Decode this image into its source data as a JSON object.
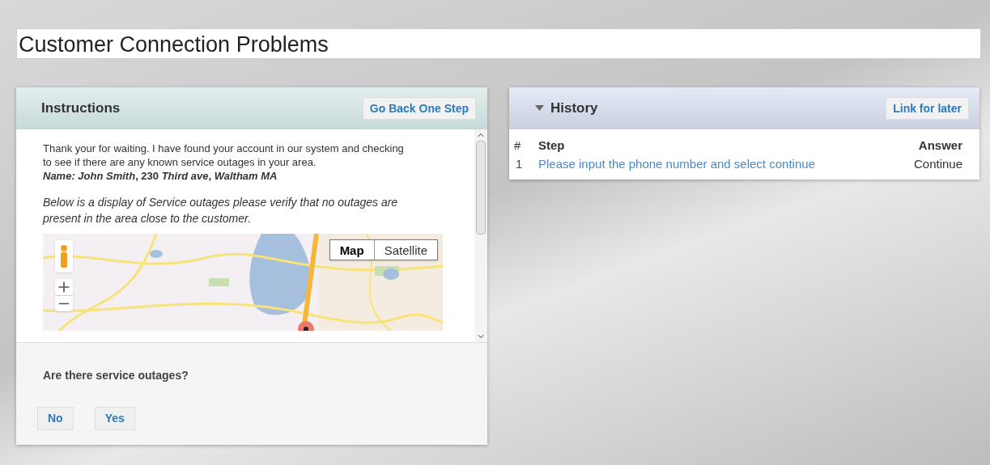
{
  "title": "Customer Connection Problems",
  "instructions": {
    "heading": "Instructions",
    "back_button": "Go Back One Step",
    "paragraphs": [
      "Thank your for waiting.  I have found your account in our system and checking to see if there are any known service outages in your area.",
      "*Name: John Smith*, 230 *Third ave*, *Waltham MA*",
      "Below is a display of Service outages please verify that no outages are present in the area close to the customer."
    ],
    "map": {
      "kind": "picture",
      "map_types": [
        {
          "label": "Map",
          "selected": true
        },
        {
          "label": "Satellite",
          "selected": false
        }
      ]
    },
    "question": "Are there service outages?",
    "answers": [
      "No",
      "Yes"
    ]
  },
  "history": {
    "heading": "History",
    "expanded": true,
    "link_button": "Link for later",
    "columns": [
      "#",
      "Step",
      "Answer"
    ],
    "rows": [
      {
        "number": "1",
        "step": "Please input the phone number and select continue",
        "answer": "Continue"
      }
    ]
  }
}
